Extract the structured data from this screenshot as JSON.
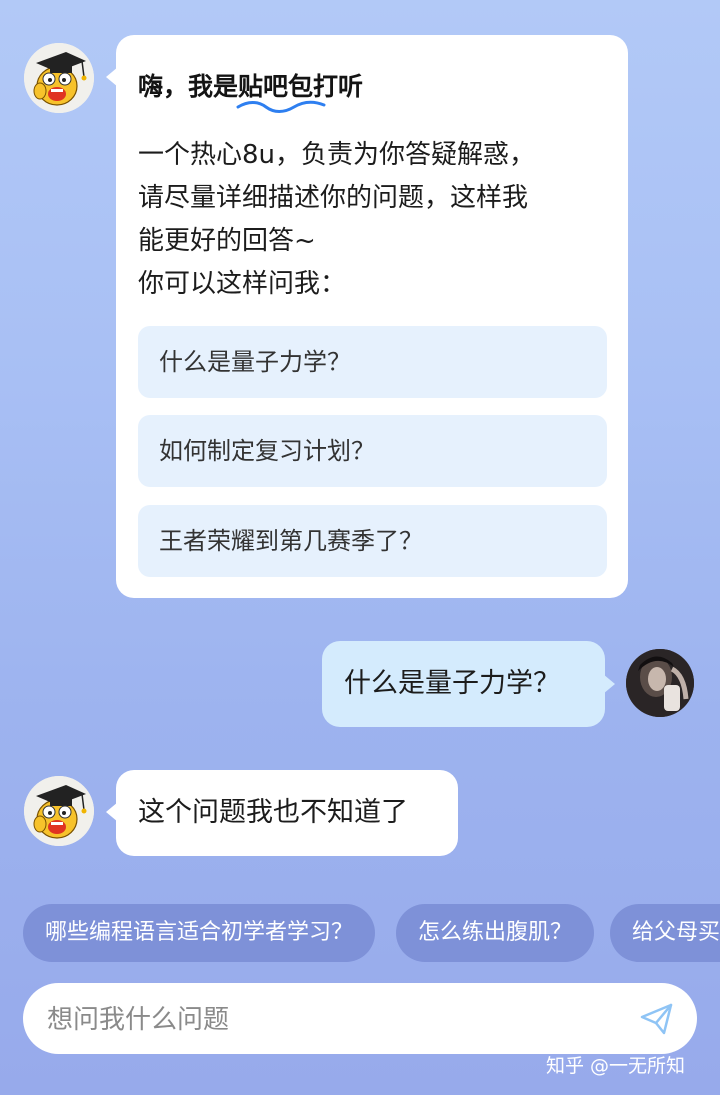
{
  "greeting": {
    "title_prefix": "嗨，我是",
    "title_brand": "贴吧包打听",
    "paragraph_lines": [
      "一个热心8u，负责为你答疑解惑，",
      "请尽量详细描述你的问题，这样我",
      "能更好的回答~",
      "你可以这样问我："
    ],
    "suggestions": [
      "什么是量子力学？",
      "如何制定复习计划？",
      "王者荣耀到第几赛季了？"
    ]
  },
  "user_message": "什么是量子力学？",
  "bot_reply": "这个问题我也不知道了",
  "quick_chips": [
    "哪些编程语言适合初学者学习？",
    "怎么练出腹肌？",
    "给父母买"
  ],
  "input": {
    "placeholder": "想问我什么问题",
    "value": ""
  },
  "watermark": "知乎 @一无所知",
  "colors": {
    "accent": "#3a8ef0",
    "chip_bg": "#7e91d8",
    "user_bubble": "#d4ebfd",
    "suggestion_bg": "#e6f1fd"
  },
  "icons": {
    "bot_avatar": "cartoon-graduate-face",
    "user_avatar": "user-photo",
    "send": "paper-plane-icon"
  }
}
